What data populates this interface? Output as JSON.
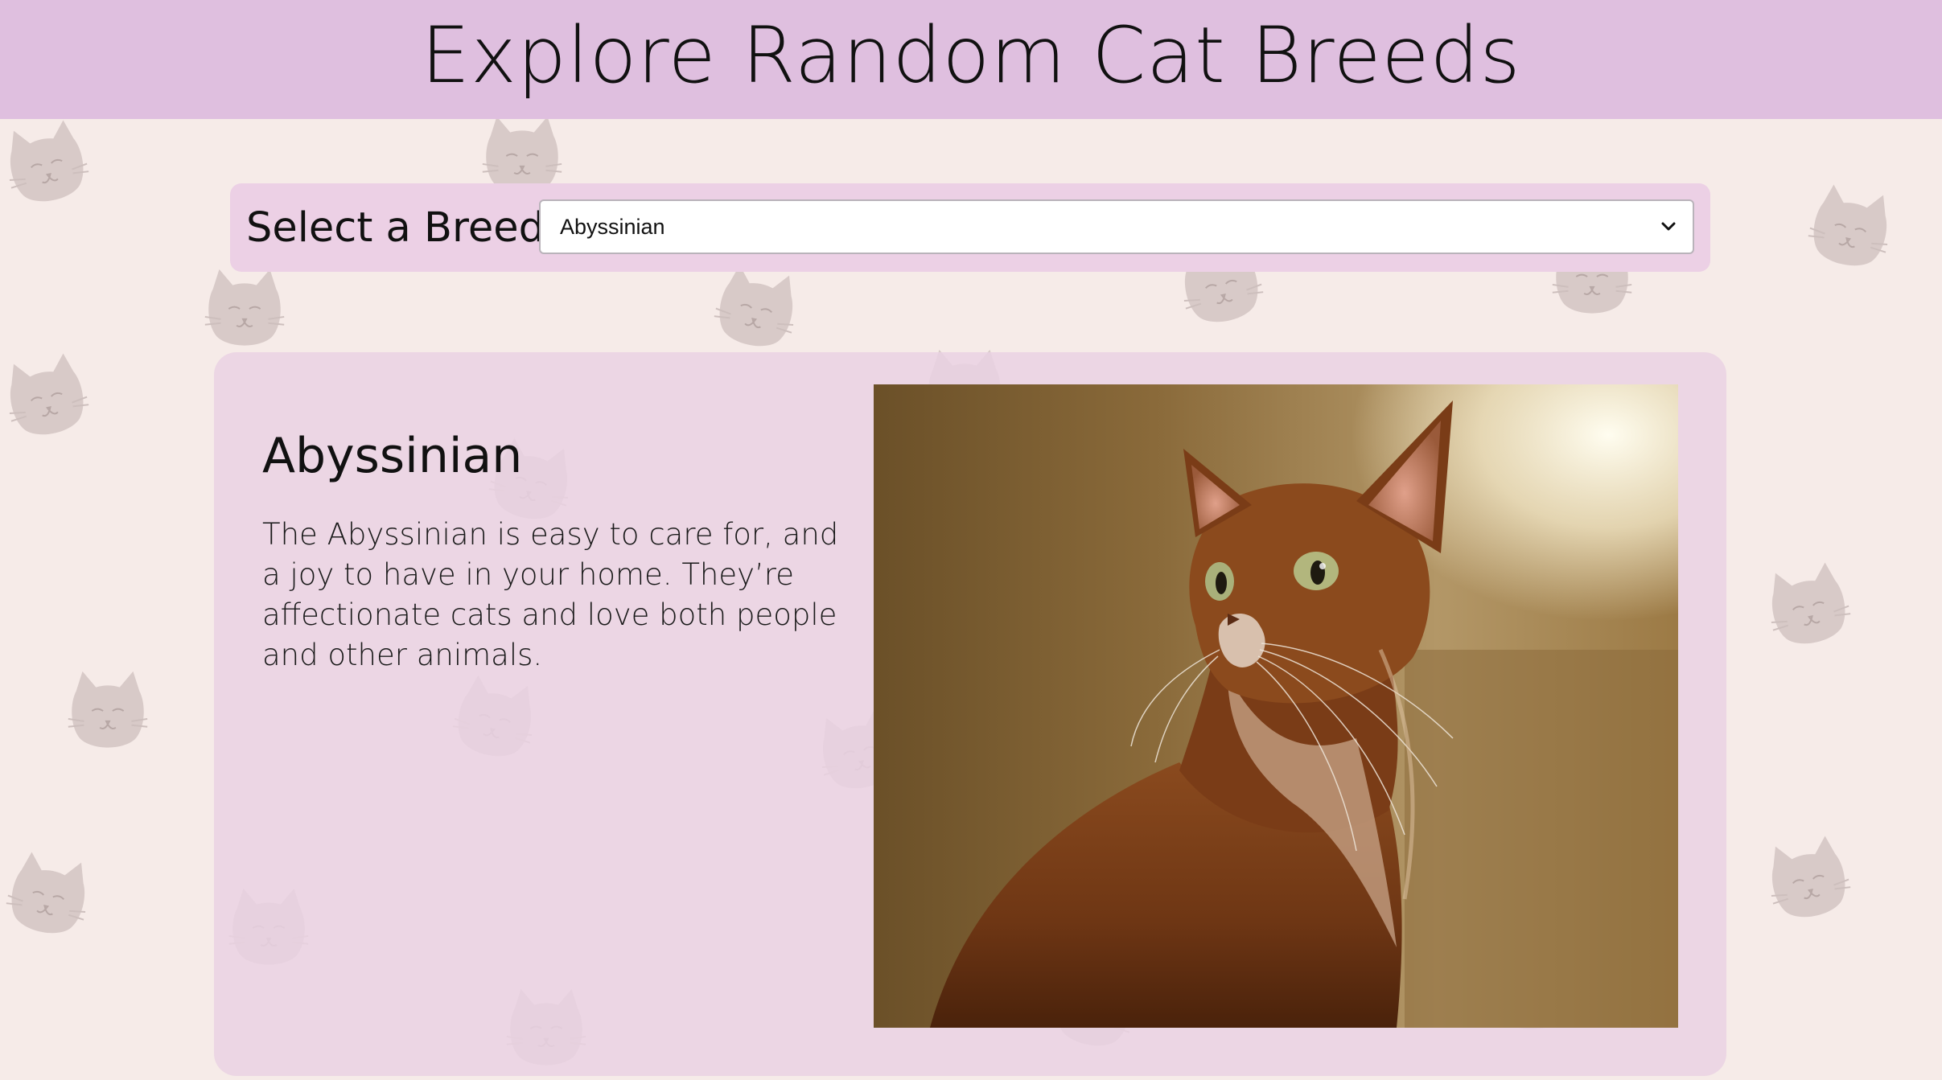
{
  "header": {
    "title": "Explore Random Cat Breeds"
  },
  "selector": {
    "label": "Select a Breed:",
    "selected_value": "Abyssinian"
  },
  "breed": {
    "name": "Abyssinian",
    "description": "The Abyssinian is easy to care for, and a joy to have in your home. They’re affectionate cats and love both people and other animals.",
    "image_icon": "cat-photo"
  },
  "theme": {
    "header_bg": "#dfbfdf",
    "page_bg": "#f6ebe8",
    "panel_bg": "#ecd0e5",
    "pattern_icon": "cat-face-icon"
  }
}
